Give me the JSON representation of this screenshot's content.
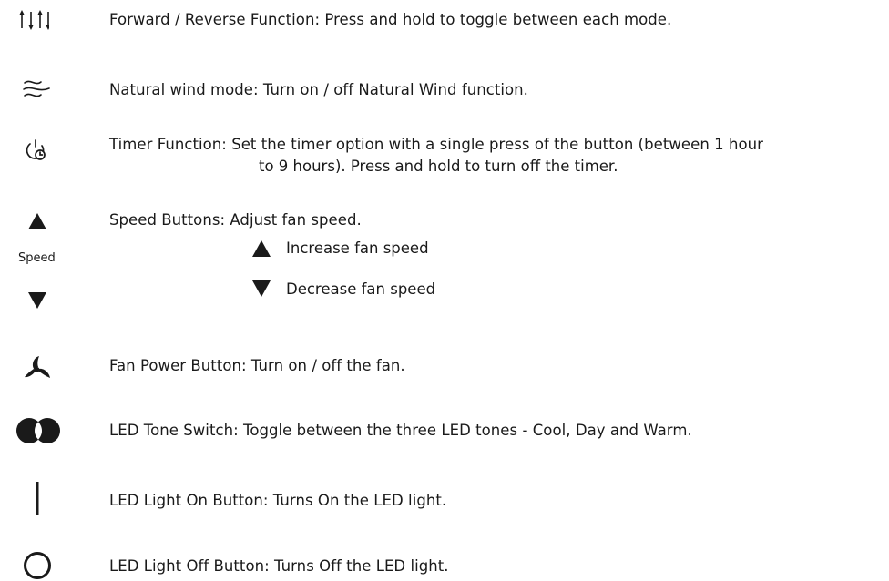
{
  "rows": [
    {
      "icon": "forward-reverse-arrows-icon",
      "text": "Forward / Reverse Function: Press and hold to toggle between each mode."
    },
    {
      "icon": "natural-wind-icon",
      "text": "Natural wind mode: Turn on / off Natural Wind function."
    },
    {
      "icon": "timer-icon",
      "text": "Timer Function: Set the timer option with a single press of the button (between 1 hour",
      "text_cont": "to 9 hours). Press and hold to turn off the timer."
    },
    {
      "icon": "speed-up-down-icon",
      "icon_label": "Speed",
      "text": "Speed Buttons: Adjust fan speed.",
      "sub_items": [
        {
          "icon": "triangle-up-icon",
          "text": "Increase fan speed"
        },
        {
          "icon": "triangle-down-icon",
          "text": "Decrease fan speed"
        }
      ]
    },
    {
      "icon": "fan-power-icon",
      "text": "Fan Power Button: Turn on / off the fan."
    },
    {
      "icon": "led-tone-icon",
      "text": "LED Tone Switch: Toggle between the three LED tones - Cool, Day and Warm."
    },
    {
      "icon": "led-on-icon",
      "text": "LED Light On Button: Turns On the LED light."
    },
    {
      "icon": "led-off-icon",
      "text": "LED Light Off Button: Turns Off the LED light."
    }
  ]
}
